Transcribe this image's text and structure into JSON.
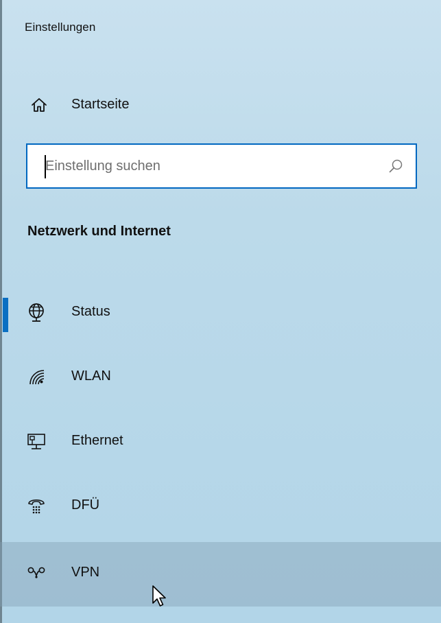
{
  "app": {
    "title": "Einstellungen"
  },
  "home": {
    "label": "Startseite",
    "icon": "home-icon"
  },
  "search": {
    "placeholder": "Einstellung suchen",
    "value": "",
    "icon": "search-icon"
  },
  "section": {
    "title": "Netzwerk und Internet"
  },
  "nav": {
    "items": [
      {
        "label": "Status",
        "icon": "globe-icon",
        "state": "selected"
      },
      {
        "label": "WLAN",
        "icon": "wifi-icon",
        "state": "normal"
      },
      {
        "label": "Ethernet",
        "icon": "ethernet-icon",
        "state": "normal"
      },
      {
        "label": "DFÜ",
        "icon": "dialup-icon",
        "state": "normal"
      },
      {
        "label": "VPN",
        "icon": "vpn-icon",
        "state": "hover"
      }
    ]
  },
  "colors": {
    "accent": "#0a6fc2",
    "search_border": "#0067c0",
    "background": "#bcdaea",
    "hover": "#a2c4d6"
  }
}
